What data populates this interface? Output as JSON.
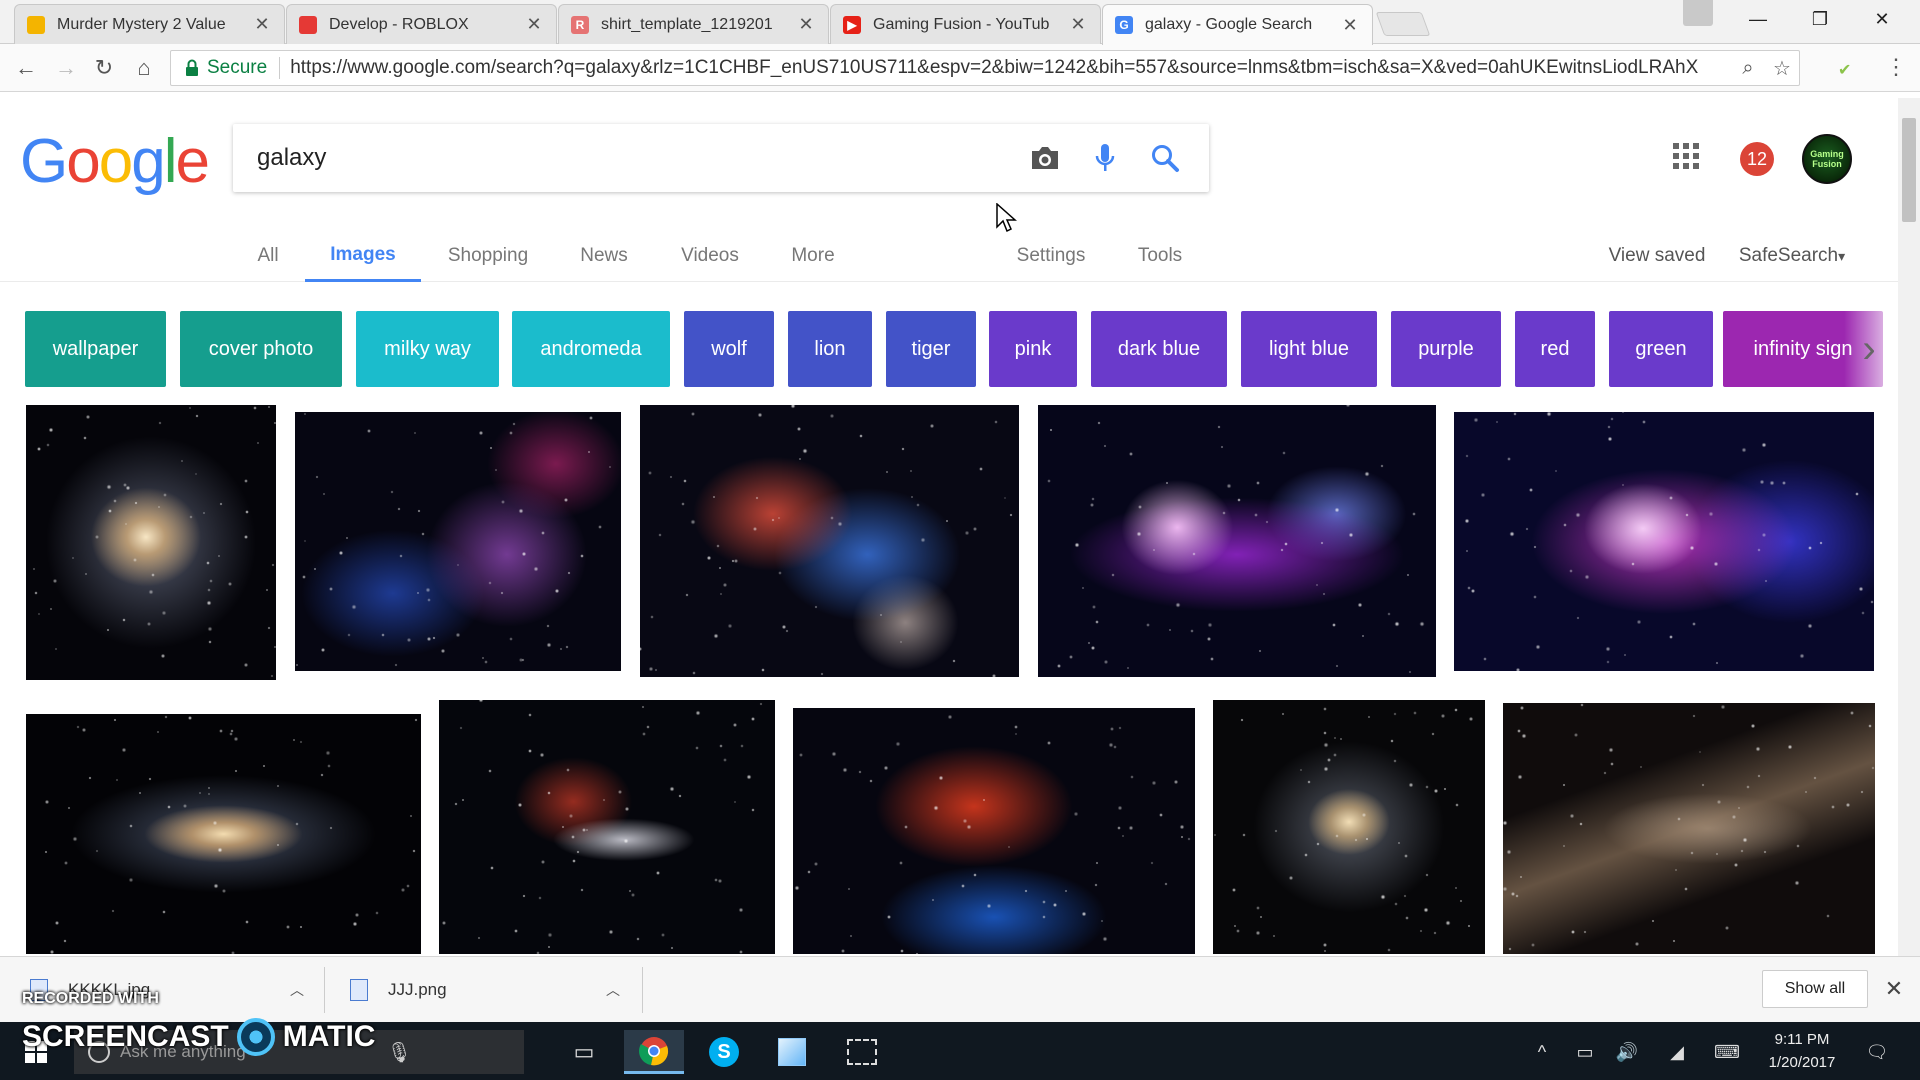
{
  "browser": {
    "tabs": [
      {
        "title": "Murder Mystery 2 Value",
        "favicon_color": "#f4b400",
        "favicon_char": ""
      },
      {
        "title": "Develop - ROBLOX",
        "favicon_color": "#e53935",
        "favicon_char": ""
      },
      {
        "title": "shirt_template_1219201",
        "favicon_color": "#e57373",
        "favicon_char": "R"
      },
      {
        "title": "Gaming Fusion - YouTub",
        "favicon_color": "#e62117",
        "favicon_char": "▶"
      },
      {
        "title": "galaxy - Google Search",
        "favicon_color": "#4285f4",
        "favicon_char": "G",
        "active": true
      }
    ],
    "tab_close_glyph": "✕",
    "window_controls": {
      "minimize": "—",
      "maximize": "❐",
      "close": "✕"
    },
    "nav": {
      "back": "←",
      "forward": "→",
      "reload": "↻",
      "home": "⌂"
    },
    "secure_label": "Secure",
    "url": "https://www.google.com/search?q=galaxy&rlz=1C1CHBF_enUS710US711&espv=2&biw=1242&bih=557&source=lnms&tbm=isch&sa=X&ved=0ahUKEwitnsLiodLRAhX",
    "zoom_glyph": "⌕",
    "star_glyph": "☆",
    "menu_glyph": "⋮"
  },
  "google": {
    "logo_letters": [
      {
        "ch": "G",
        "color": "#4285f4"
      },
      {
        "ch": "o",
        "color": "#ea4335"
      },
      {
        "ch": "o",
        "color": "#fbbc05"
      },
      {
        "ch": "g",
        "color": "#4285f4"
      },
      {
        "ch": "l",
        "color": "#34a853"
      },
      {
        "ch": "e",
        "color": "#ea4335"
      }
    ],
    "query": "galaxy",
    "notification_count": "12",
    "avatar_text": "Gaming Fusion",
    "tabs": [
      {
        "label": "All"
      },
      {
        "label": "Images",
        "active": true
      },
      {
        "label": "Shopping"
      },
      {
        "label": "News"
      },
      {
        "label": "Videos"
      },
      {
        "label": "More"
      },
      {
        "label": "Settings"
      },
      {
        "label": "Tools"
      }
    ],
    "view_saved": "View saved",
    "safesearch": "SafeSearch",
    "chips": [
      {
        "label": "wallpaper",
        "color": "#159e8e"
      },
      {
        "label": "cover photo",
        "color": "#159e8e"
      },
      {
        "label": "milky way",
        "color": "#1bbccc"
      },
      {
        "label": "andromeda",
        "color": "#1bbccc"
      },
      {
        "label": "wolf",
        "color": "#4353c8"
      },
      {
        "label": "lion",
        "color": "#4353c8"
      },
      {
        "label": "tiger",
        "color": "#4353c8"
      },
      {
        "label": "pink",
        "color": "#6a3acb"
      },
      {
        "label": "dark blue",
        "color": "#6a3acb"
      },
      {
        "label": "light blue",
        "color": "#6a3acb"
      },
      {
        "label": "purple",
        "color": "#6a3acb"
      },
      {
        "label": "red",
        "color": "#6a3acb"
      },
      {
        "label": "green",
        "color": "#6a3acb"
      },
      {
        "label": "infinity sign",
        "color": "#9c27b0"
      }
    ],
    "chips_next_glyph": "›",
    "images": [
      {
        "subject": "spiral galaxy"
      },
      {
        "subject": "star field nebula"
      },
      {
        "subject": "colorful nebula"
      },
      {
        "subject": "purple nebula"
      },
      {
        "subject": "pink blue nebula"
      },
      {
        "subject": "barred spiral galaxy"
      },
      {
        "subject": "cigar galaxy"
      },
      {
        "subject": "red nebula"
      },
      {
        "subject": "spiral galaxy"
      },
      {
        "subject": "milky way"
      }
    ]
  },
  "downloads": {
    "items": [
      {
        "name": "KKKKL.jpg"
      },
      {
        "name": "JJJ.png"
      }
    ],
    "show_all": "Show all",
    "close_glyph": "✕",
    "caret_glyph": "︿"
  },
  "taskbar": {
    "search_placeholder": "Ask me anything",
    "time": "9:11 PM",
    "date": "1/20/2017"
  },
  "watermark": {
    "recorded_with": "RECORDED WITH",
    "brand_left": "SCREENCAST",
    "brand_right": "MATIC"
  }
}
